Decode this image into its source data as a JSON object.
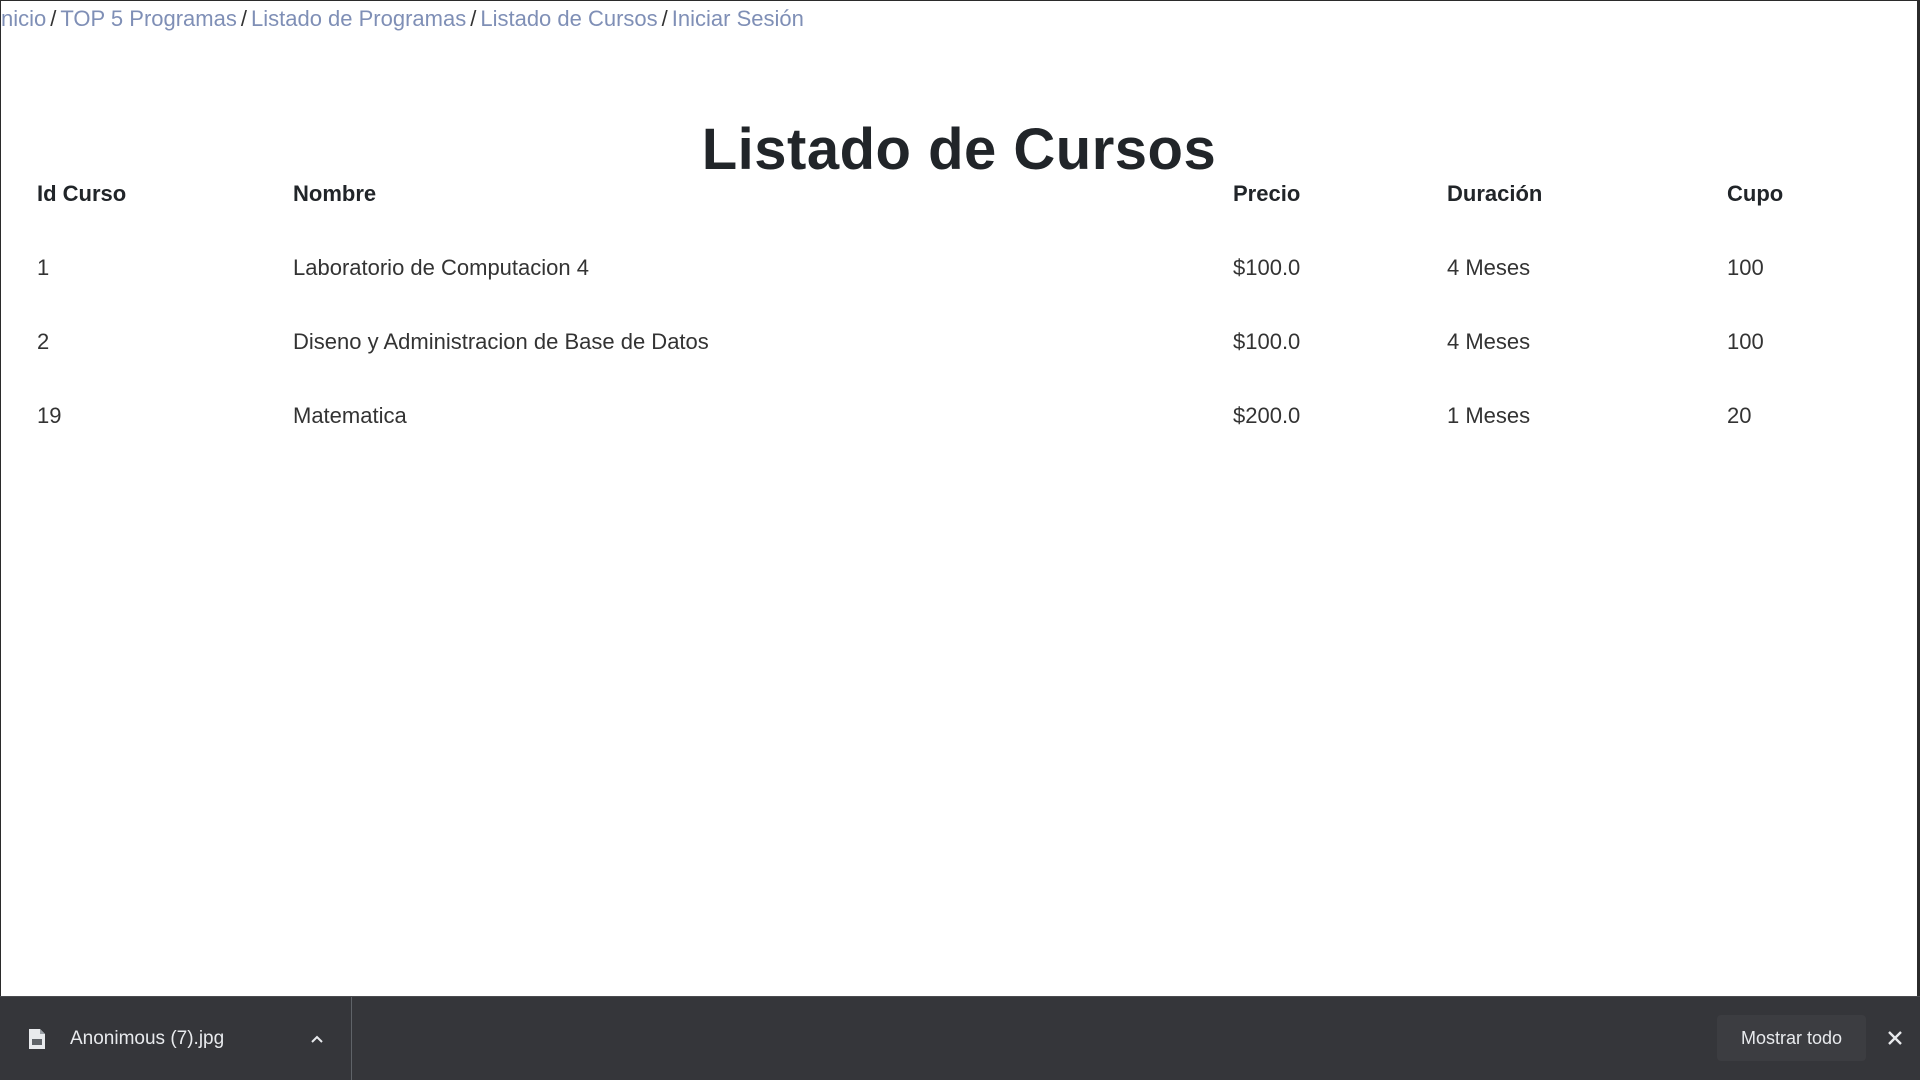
{
  "breadcrumb": {
    "items": [
      {
        "label": "nicio"
      },
      {
        "label": "TOP 5 Programas"
      },
      {
        "label": "Listado de Programas"
      },
      {
        "label": "Listado de Cursos"
      },
      {
        "label": "Iniciar Sesión"
      }
    ],
    "separator": "/"
  },
  "page": {
    "title": "Listado de Cursos"
  },
  "table": {
    "headers": [
      "Id Curso",
      "Nombre",
      "Precio",
      "Duración",
      "Cupo"
    ],
    "rows": [
      [
        "1",
        "Laboratorio de Computacion 4",
        "$100.0",
        "4 Meses",
        "100"
      ],
      [
        "2",
        "Diseno y Administracion de Base de Datos",
        "$100.0",
        "4 Meses",
        "100"
      ],
      [
        "19",
        "Matematica",
        "$200.0",
        "1 Meses",
        "20"
      ]
    ]
  },
  "downloads": {
    "file_name": "Anonimous (7).jpg",
    "file_icon": "file-icon",
    "expand_icon": "chevron-up-icon",
    "show_all_label": "Mostrar todo",
    "close_icon": "close-icon"
  },
  "colors": {
    "link": "#7f8fb6",
    "downloads_bar": "#35363a",
    "text": "#212529"
  }
}
